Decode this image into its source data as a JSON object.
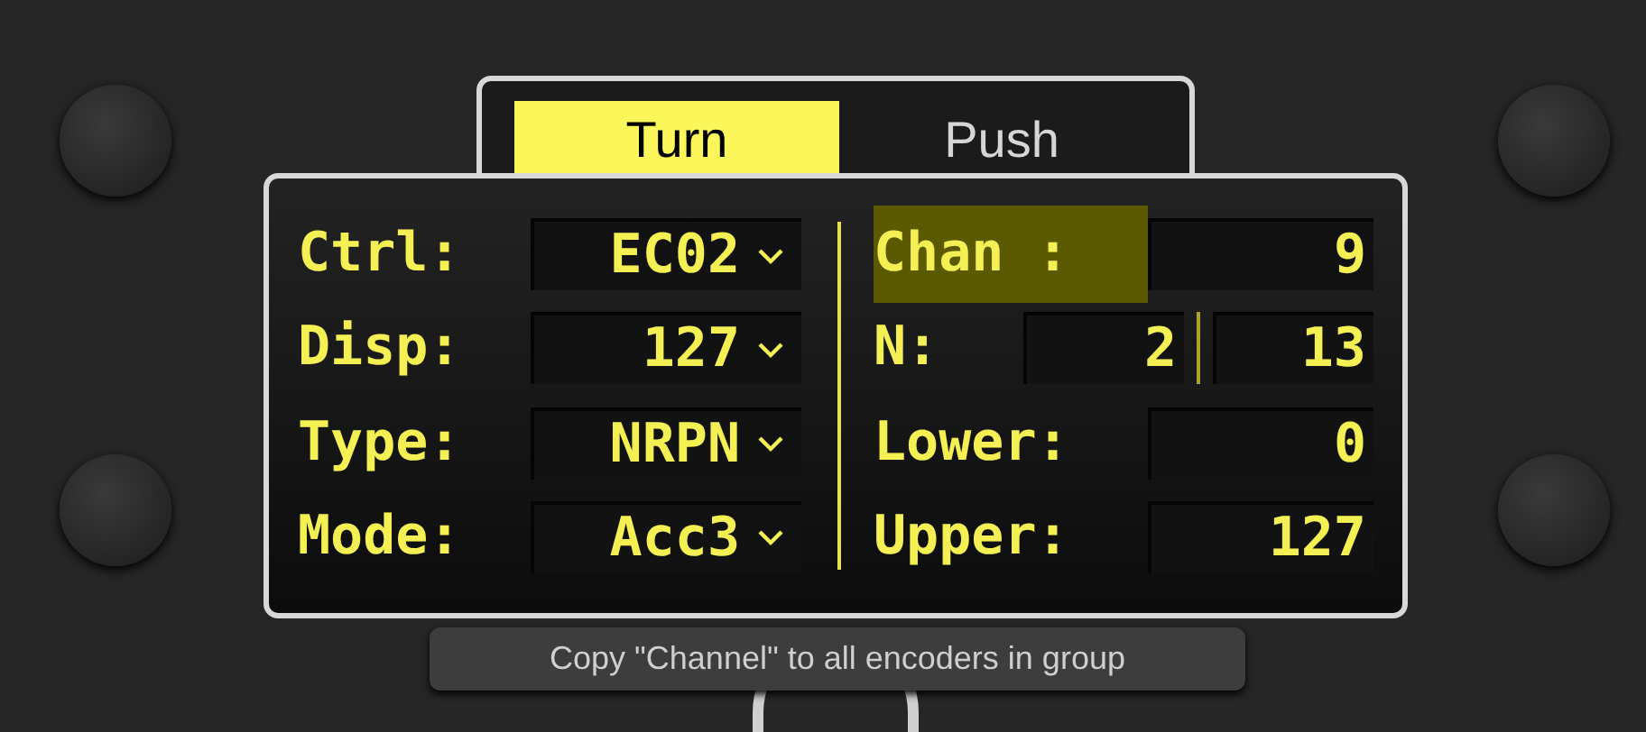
{
  "tabs": [
    {
      "label": "Turn",
      "selected": true
    },
    {
      "label": "Push",
      "selected": false
    }
  ],
  "left_fields": [
    {
      "label": "Ctrl:",
      "value": "EC02"
    },
    {
      "label": "Disp:",
      "value": "127"
    },
    {
      "label": "Type:",
      "value": "NRPN"
    },
    {
      "label": "Mode:",
      "value": "Acc3"
    }
  ],
  "right_fields": [
    {
      "label": "Chan :",
      "selected": true,
      "values": [
        "9"
      ]
    },
    {
      "label": "N:",
      "selected": false,
      "values": [
        "2",
        "13"
      ]
    },
    {
      "label": "Lower:",
      "selected": false,
      "values": [
        "0"
      ]
    },
    {
      "label": "Upper:",
      "selected": false,
      "values": [
        "127"
      ]
    }
  ],
  "tooltip": "Copy \"Channel\" to all encoders in group"
}
